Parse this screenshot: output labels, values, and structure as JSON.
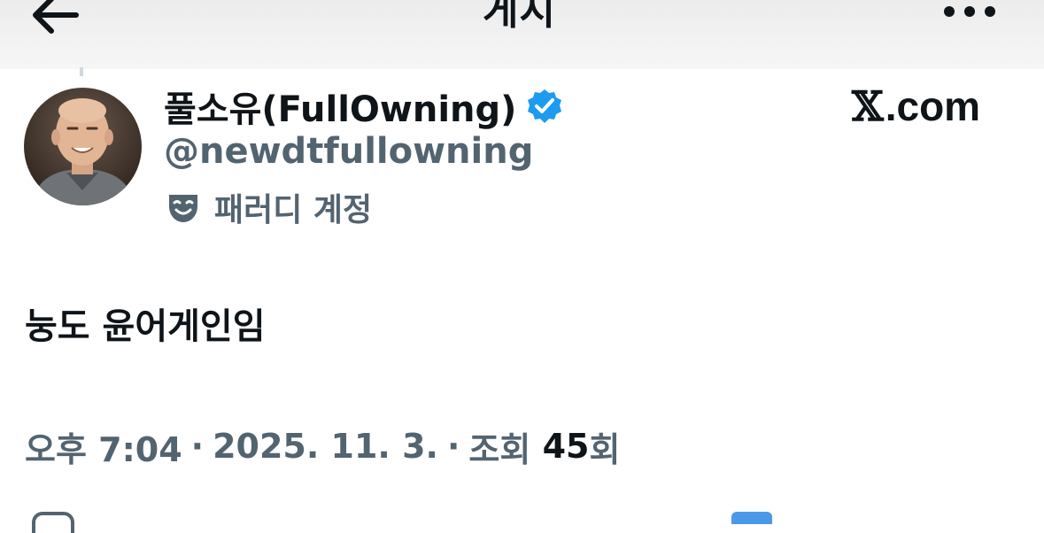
{
  "header": {
    "title": "게시",
    "back_icon": "arrow-left-icon",
    "more_icon": "more-dots-icon"
  },
  "author": {
    "display_name": "풀소유(FullOwning)",
    "handle": "@newdtfullowning",
    "verified_icon": "verified-badge-icon",
    "parody_icon": "theater-mask-icon",
    "parody_label": "패러디 계정"
  },
  "site": {
    "logo_mark": "𝕏",
    "logo_text": ".com"
  },
  "post": {
    "text": "눙도 윤어게인임"
  },
  "meta": {
    "time": "오후 7:04",
    "separator": "·",
    "date": "2025. 11. 3.",
    "views_prefix": "조회",
    "views_count": "45",
    "views_suffix": "회"
  },
  "colors": {
    "text_primary": "#0f1419",
    "text_secondary": "#536471",
    "verified_blue": "#1d9bf0",
    "header_bg": "#f2f2f2"
  }
}
